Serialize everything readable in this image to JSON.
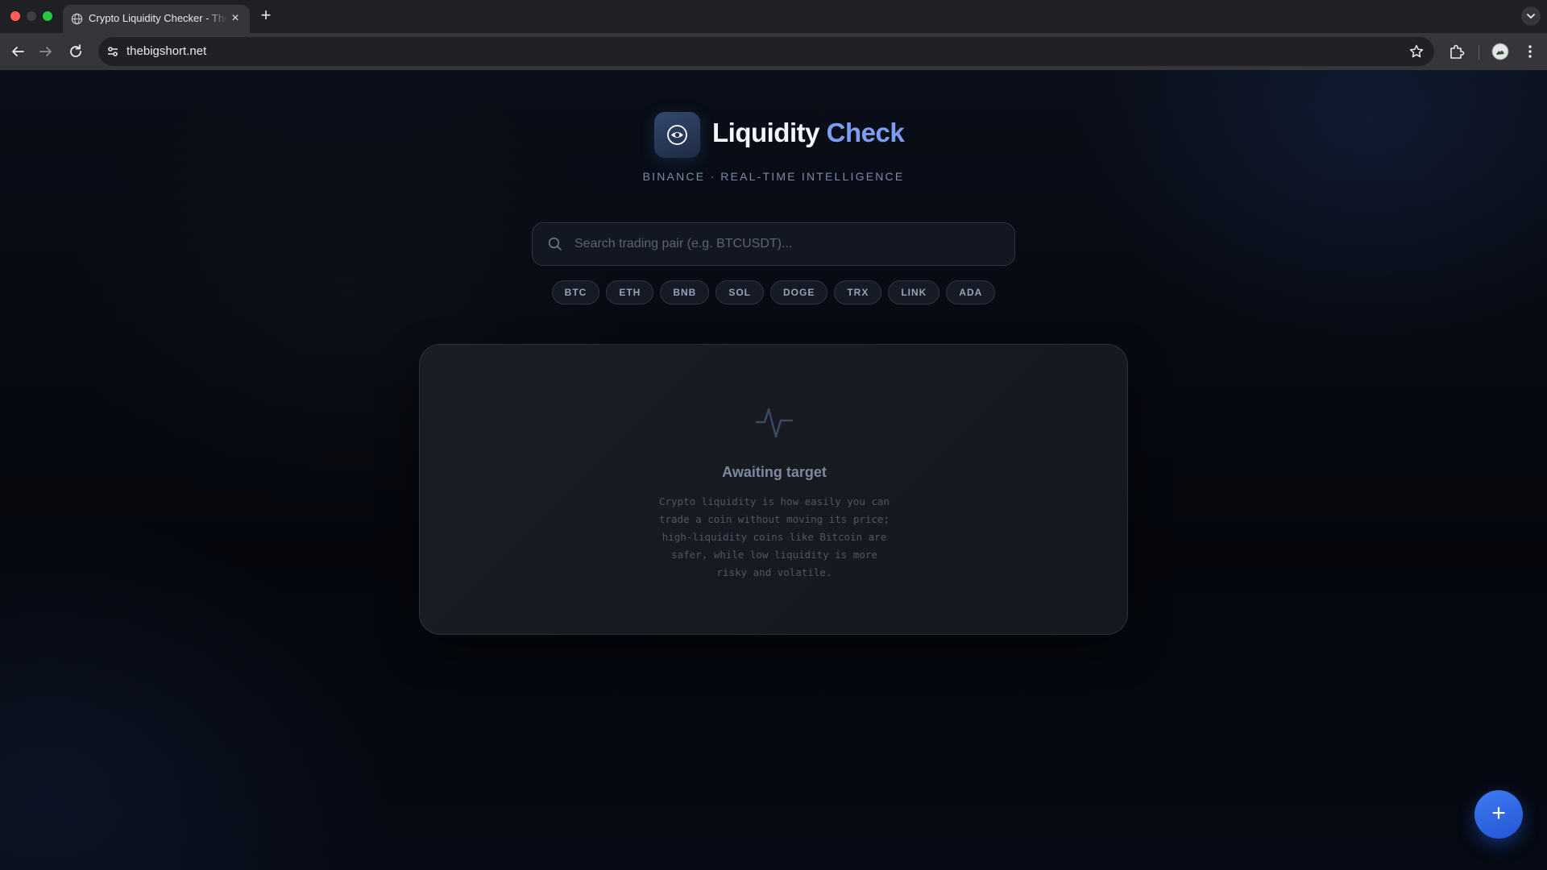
{
  "browser": {
    "tab_title": "Crypto Liquidity Checker - The Big Short",
    "tab_close": "×",
    "new_tab": "+",
    "url": "thebigshort.net"
  },
  "header": {
    "brand_part1": "Liquidity",
    "brand_part2": "Check",
    "tagline": "BINANCE · REAL-TIME INTELLIGENCE"
  },
  "search": {
    "placeholder": "Search trading pair (e.g. BTCUSDT)...",
    "value": ""
  },
  "quick_pairs": [
    "BTC",
    "ETH",
    "BNB",
    "SOL",
    "DOGE",
    "TRX",
    "LINK",
    "ADA"
  ],
  "empty_state": {
    "icon": "activity-pulse-icon",
    "title": "Awaiting target",
    "description": "Crypto liquidity is how easily you can trade a coin without moving its price; high-liquidity coins like Bitcoin are safer, while low liquidity is more risky and volatile."
  },
  "fab": {
    "label": "+"
  },
  "colors": {
    "accent": "#7d9df0",
    "fab": "#2f66e6",
    "background": "#05070d"
  }
}
